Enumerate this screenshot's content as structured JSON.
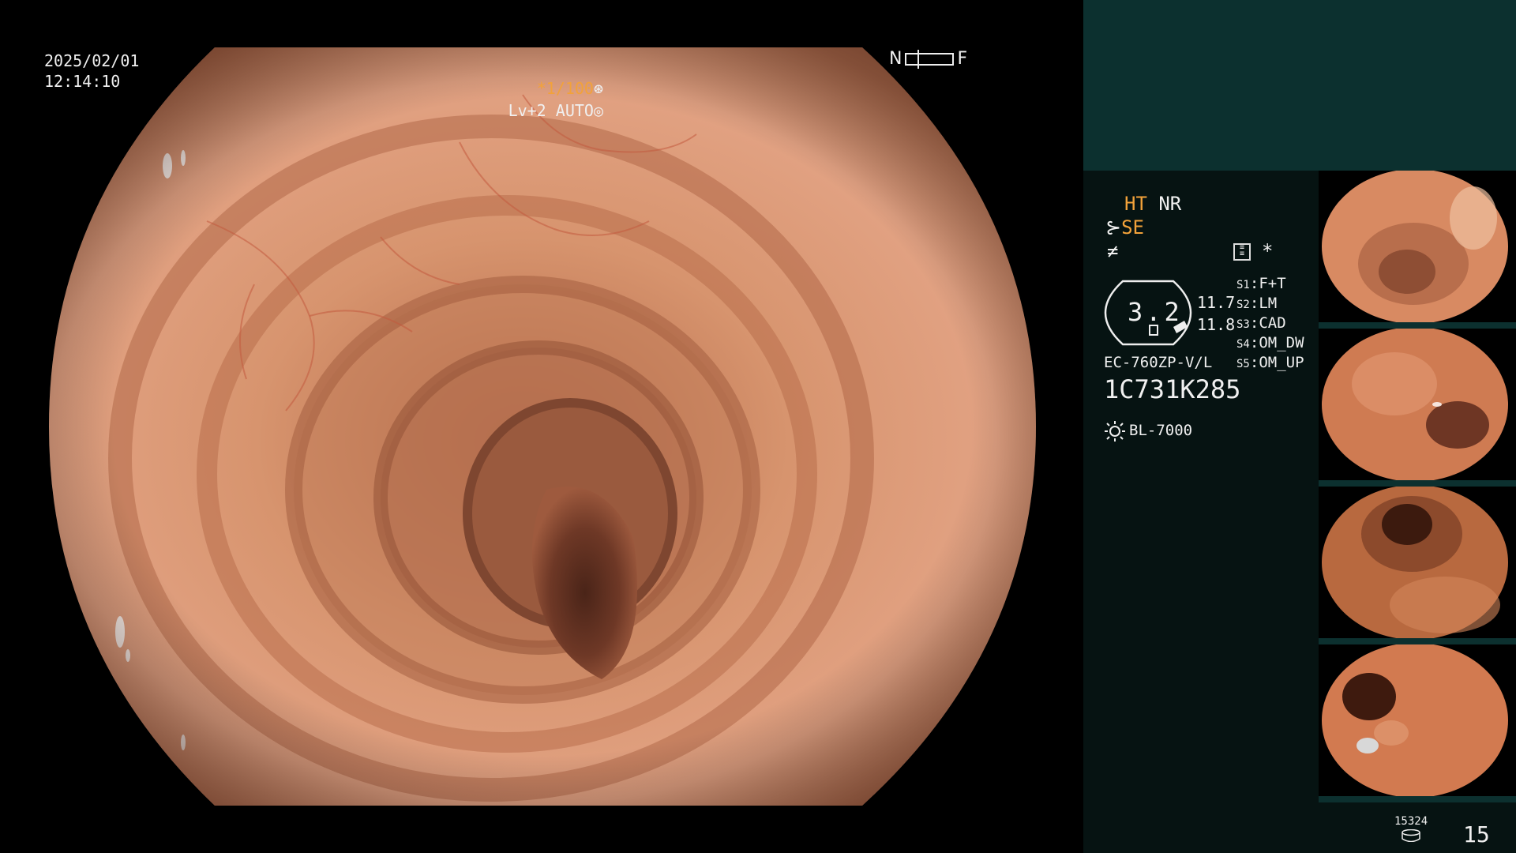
{
  "overlay": {
    "date": "2025/02/01",
    "time": "12:14:10",
    "near_label": "N",
    "far_label": "F",
    "shutter": "*1/100",
    "level": "Lv+2",
    "mode": "AUTO"
  },
  "panel": {
    "ht": "HT",
    "nr": "NR",
    "se": "SE",
    "star": "*",
    "gauge_value": "3.2",
    "value_a": "11.7",
    "value_b": "11.8",
    "model": "EC-760ZP-V/L",
    "serial": "1C731K285",
    "light_source": "BL-7000",
    "settings": [
      {
        "key": "S1",
        "value": "F+T"
      },
      {
        "key": "S2",
        "value": "LM"
      },
      {
        "key": "S3",
        "value": "CAD"
      },
      {
        "key": "S4",
        "value": "OM_DW"
      },
      {
        "key": "S5",
        "value": "OM_UP"
      }
    ],
    "counter_small": "15324",
    "counter_big": "15"
  },
  "colors": {
    "accent_orange": "#f2a23a",
    "panel_bg": "#061312",
    "panel_teal": "#0c302f",
    "mucosa": "#c7774f"
  }
}
